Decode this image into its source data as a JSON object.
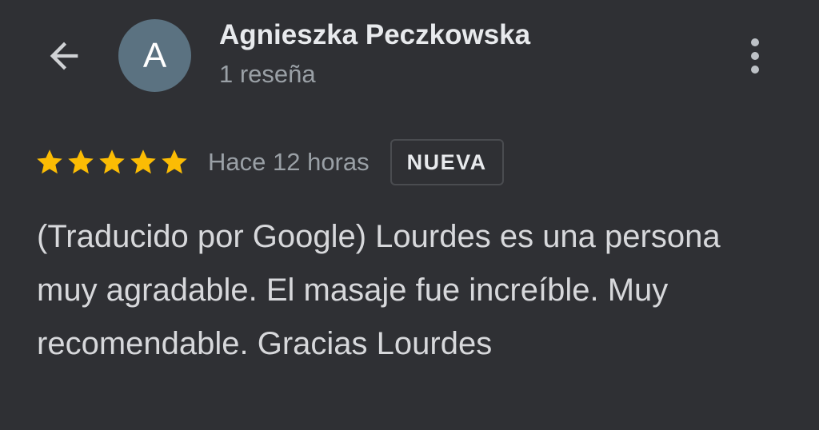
{
  "header": {
    "back_icon": "arrow-left-icon",
    "avatar_letter": "A",
    "avatar_color": "#5b7281",
    "user_name": "Agnieszka Peczkowska",
    "review_count": "1 reseña",
    "more_icon": "more-vertical-icon"
  },
  "review": {
    "rating": 5,
    "max_rating": 5,
    "star_color": "#fbbc04",
    "star_icon": "star-icon",
    "time_ago": "Hace 12 horas",
    "badge": "NUEVA",
    "text": "(Traducido por Google) Lourdes es una persona muy agradable. El masaje fue increíble. Muy recomendable. Gracias Lourdes"
  },
  "colors": {
    "background": "#2f3034",
    "primary_text": "#e8eaed",
    "secondary_text": "#9aa0a6"
  }
}
